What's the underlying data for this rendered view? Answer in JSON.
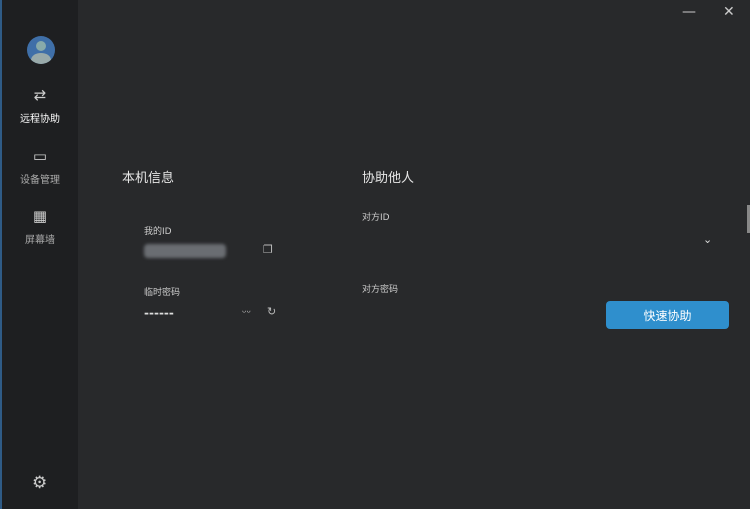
{
  "window": {
    "minimize": "—",
    "close": "✕"
  },
  "sidebar": {
    "items": [
      {
        "label": "远程协助",
        "icon": "⇄"
      },
      {
        "label": "设备管理",
        "icon": "▭"
      },
      {
        "label": "屏幕墙",
        "icon": "▦"
      }
    ],
    "settings_icon": "⚙"
  },
  "local": {
    "title": "本机信息",
    "id_label": "我的ID",
    "password_label": "临时密码",
    "password_value": "------"
  },
  "remote": {
    "title": "协助他人",
    "id_label": "对方ID",
    "password_label": "对方密码",
    "connect_button": "快速协助"
  },
  "colors": {
    "accent": "#2f8fcd"
  }
}
